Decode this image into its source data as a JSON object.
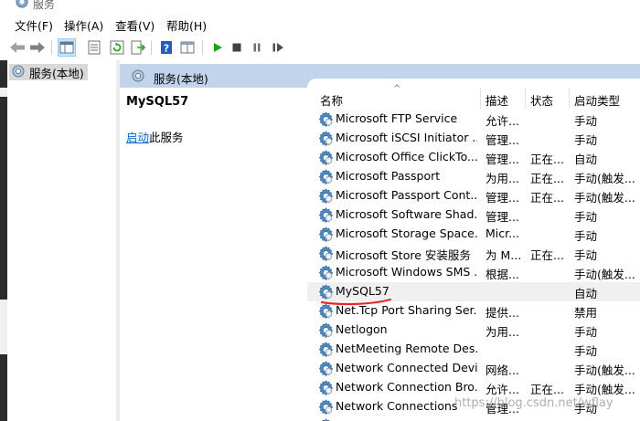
{
  "window": {
    "title": "服务"
  },
  "menu": [
    "文件(F)",
    "操作(A)",
    "查看(V)",
    "帮助(H)"
  ],
  "tree": {
    "item_label": "服务(本地)"
  },
  "pane": {
    "header_title": "服务(本地)"
  },
  "detail": {
    "service_name": "MySQL57",
    "start_link": "启动",
    "start_suffix": "此服务"
  },
  "columns": {
    "name": "名称",
    "description": "描述",
    "status": "状态",
    "startup": "启动类型"
  },
  "services": [
    {
      "name": "Microsoft FTP Service",
      "desc": "允许...",
      "status": "",
      "startup": "手动"
    },
    {
      "name": "Microsoft iSCSI Initiator ...",
      "desc": "管理...",
      "status": "",
      "startup": "手动"
    },
    {
      "name": "Microsoft Office ClickTo...",
      "desc": "管理...",
      "status": "正在...",
      "startup": "自动"
    },
    {
      "name": "Microsoft Passport",
      "desc": "为用...",
      "status": "正在...",
      "startup": "手动(触发..."
    },
    {
      "name": "Microsoft Passport Cont...",
      "desc": "管理...",
      "status": "正在...",
      "startup": "手动(触发..."
    },
    {
      "name": "Microsoft Software Shad...",
      "desc": "管理...",
      "status": "",
      "startup": "手动"
    },
    {
      "name": "Microsoft Storage Space...",
      "desc": "Micr...",
      "status": "",
      "startup": "手动"
    },
    {
      "name": "Microsoft Store 安装服务",
      "desc": "为 M...",
      "status": "正在...",
      "startup": "手动"
    },
    {
      "name": "Microsoft Windows SMS ...",
      "desc": "根据...",
      "status": "",
      "startup": "手动(触发..."
    },
    {
      "name": "MySQL57",
      "desc": "",
      "status": "",
      "startup": "自动"
    },
    {
      "name": "Net.Tcp Port Sharing Ser...",
      "desc": "提供...",
      "status": "",
      "startup": "禁用"
    },
    {
      "name": "Netlogon",
      "desc": "为用...",
      "status": "",
      "startup": "手动"
    },
    {
      "name": "NetMeeting Remote Des...",
      "desc": "",
      "status": "",
      "startup": "手动"
    },
    {
      "name": "Network Connected Devi...",
      "desc": "网络...",
      "status": "",
      "startup": "手动(触发..."
    },
    {
      "name": "Network Connection Bro...",
      "desc": "允许...",
      "status": "正在...",
      "startup": "手动(触发..."
    },
    {
      "name": "Network Connections",
      "desc": "管理...",
      "status": "",
      "startup": "手动"
    },
    {
      "name": "",
      "desc": "",
      "status": "",
      "startup": ""
    }
  ],
  "selected_service": "MySQL57",
  "watermark": "https://blog.csdn.net/wflay",
  "colors": {
    "pane_header": "#c2d4ec",
    "link": "#0066cc",
    "annotation": "#e8262a",
    "gear": "#3d7ab8"
  }
}
